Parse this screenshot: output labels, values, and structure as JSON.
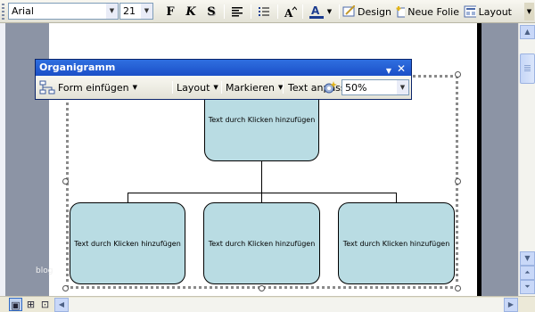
{
  "formatting_toolbar": {
    "font_name": "Arial",
    "font_size": "21",
    "bold_label": "F",
    "italic_label": "K",
    "shadow_label": "S",
    "design_label": "Design",
    "new_slide_label": "Neue Folie",
    "layout_label": "Layout"
  },
  "org_toolbar": {
    "title": "Organigramm",
    "insert_shape_label": "Form einfügen",
    "layout_label": "Layout",
    "select_label": "Markieren",
    "fit_text_label": "Text anpassen",
    "zoom_value": "50%"
  },
  "org_chart": {
    "top_box": "Text durch Klicken hinzufügen",
    "children": [
      "Text durch Klicken hinzufügen",
      "Text durch Klicken hinzufügen",
      "Text durch Klicken hinzufügen"
    ]
  },
  "watermark": "blog",
  "colors": {
    "box_fill": "#b9dce3",
    "titlebar": "#1b4fc7",
    "workspace": "#8c94a5"
  }
}
